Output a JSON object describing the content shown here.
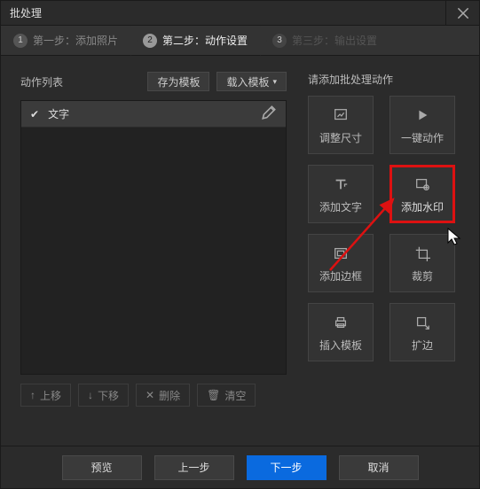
{
  "window_title": "批处理",
  "steps": [
    {
      "num": "1",
      "label": "第一步：添加照片"
    },
    {
      "num": "2",
      "label": "第二步：动作设置"
    },
    {
      "num": "3",
      "label": "第三步：输出设置"
    }
  ],
  "active_step_index": 1,
  "left": {
    "list_label": "动作列表",
    "save_template_label": "存为模板",
    "load_template_label": "载入模板",
    "row0": {
      "checked": true,
      "label": "文字"
    },
    "toolbar": {
      "move_up": "上移",
      "move_down": "下移",
      "delete": "删除",
      "clear": "清空"
    }
  },
  "right": {
    "title": "请添加批处理动作",
    "tiles": [
      {
        "id": "resize",
        "label": "调整尺寸"
      },
      {
        "id": "one-click",
        "label": "一键动作"
      },
      {
        "id": "add-text",
        "label": "添加文字"
      },
      {
        "id": "add-watermark",
        "label": "添加水印"
      },
      {
        "id": "add-border",
        "label": "添加边框"
      },
      {
        "id": "crop",
        "label": "裁剪"
      },
      {
        "id": "insert-template",
        "label": "插入模板"
      },
      {
        "id": "extend",
        "label": "扩边"
      }
    ],
    "highlight_id": "add-watermark"
  },
  "bottom": {
    "preview": "预览",
    "prev": "上一步",
    "next": "下一步",
    "cancel": "取消"
  }
}
